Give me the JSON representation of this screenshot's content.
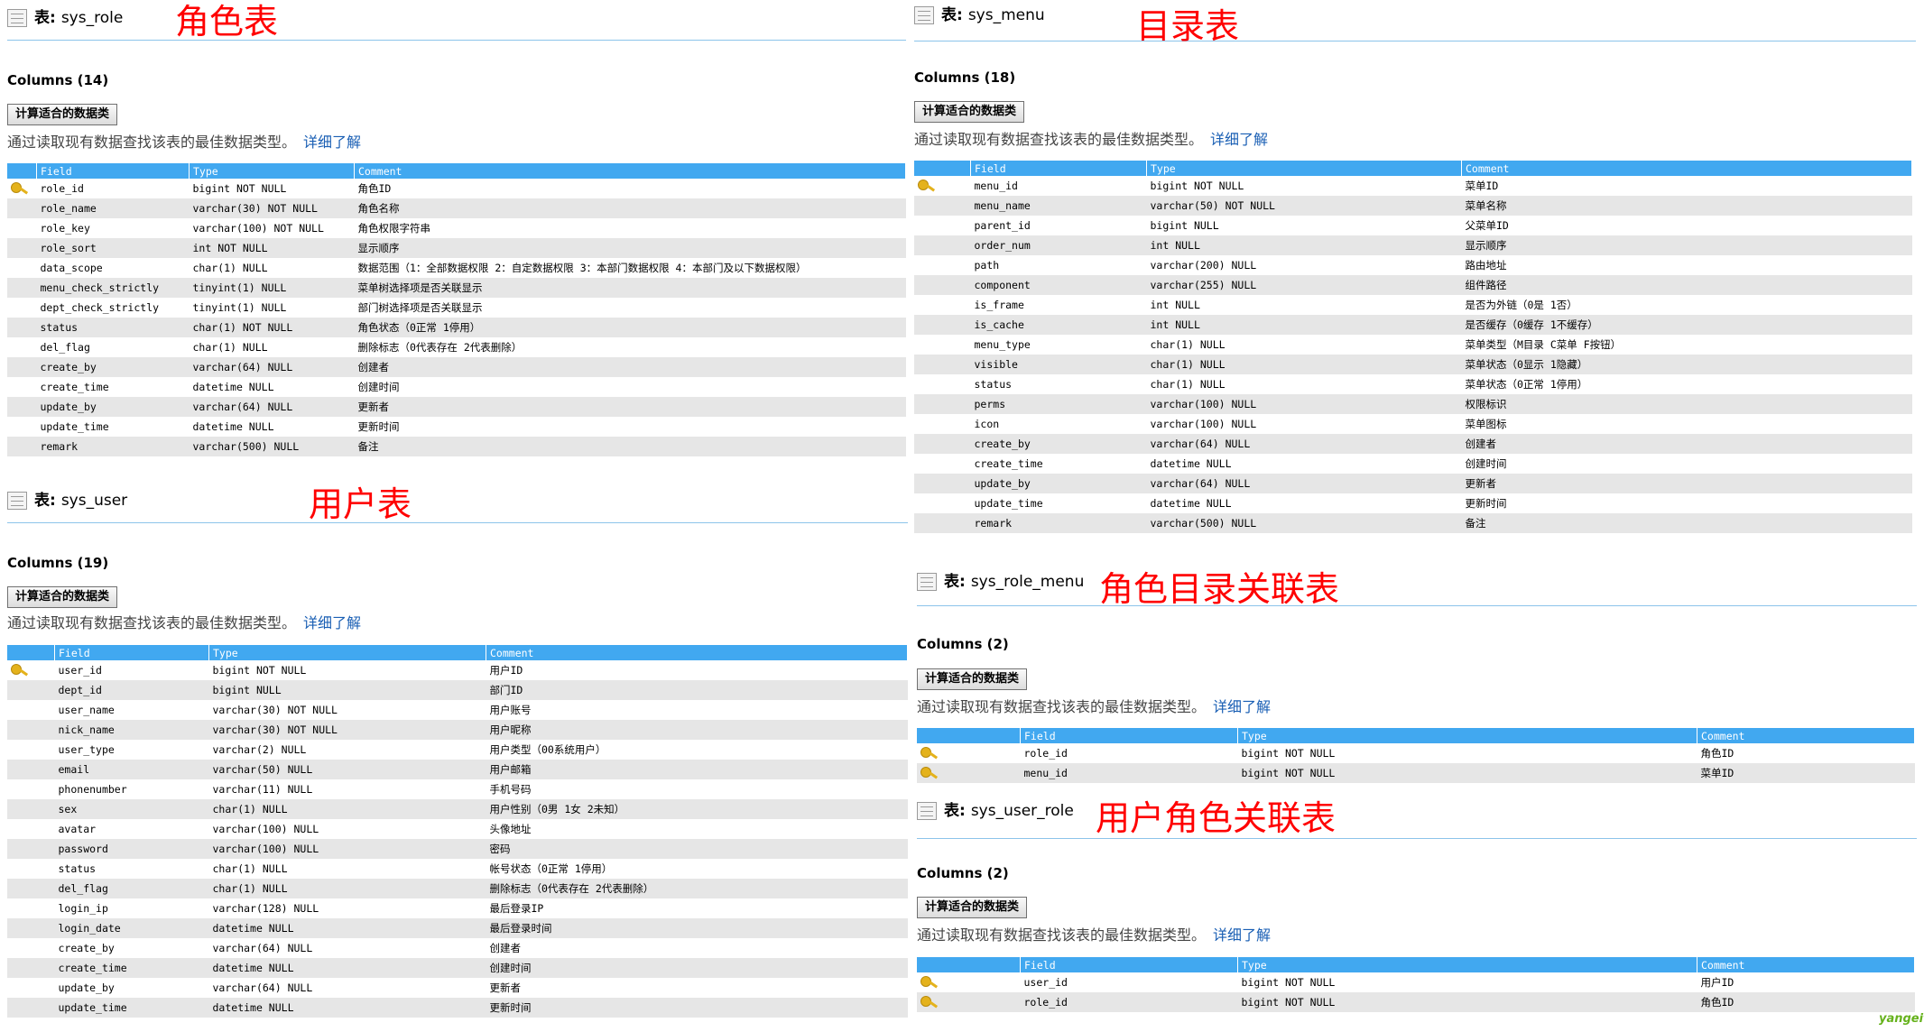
{
  "common": {
    "table_prefix": "表:",
    "calc_button": "计算适合的数据类",
    "hint_text": "通过读取现有数据查找该表的最佳数据类型。",
    "hint_link": "详细了解",
    "headers": {
      "field": "Field",
      "type": "Type",
      "comment": "Comment"
    }
  },
  "sys_role": {
    "name": "sys_role",
    "annotation": "角色表",
    "columns_label": "Columns (14)",
    "rows": [
      {
        "key": true,
        "field": "role_id",
        "type": "bigint NOT NULL",
        "comment": "角色ID"
      },
      {
        "key": false,
        "field": "role_name",
        "type": "varchar(30) NOT NULL",
        "comment": "角色名称"
      },
      {
        "key": false,
        "field": "role_key",
        "type": "varchar(100) NOT NULL",
        "comment": "角色权限字符串"
      },
      {
        "key": false,
        "field": "role_sort",
        "type": "int NOT NULL",
        "comment": "显示顺序"
      },
      {
        "key": false,
        "field": "data_scope",
        "type": "char(1) NULL",
        "comment": "数据范围（1：全部数据权限 2：自定数据权限 3：本部门数据权限 4：本部门及以下数据权限）"
      },
      {
        "key": false,
        "field": "menu_check_strictly",
        "type": "tinyint(1) NULL",
        "comment": "菜单树选择项是否关联显示"
      },
      {
        "key": false,
        "field": "dept_check_strictly",
        "type": "tinyint(1) NULL",
        "comment": "部门树选择项是否关联显示"
      },
      {
        "key": false,
        "field": "status",
        "type": "char(1) NOT NULL",
        "comment": "角色状态（0正常 1停用）"
      },
      {
        "key": false,
        "field": "del_flag",
        "type": "char(1) NULL",
        "comment": "删除标志（0代表存在 2代表删除）"
      },
      {
        "key": false,
        "field": "create_by",
        "type": "varchar(64) NULL",
        "comment": "创建者"
      },
      {
        "key": false,
        "field": "create_time",
        "type": "datetime NULL",
        "comment": "创建时间"
      },
      {
        "key": false,
        "field": "update_by",
        "type": "varchar(64) NULL",
        "comment": "更新者"
      },
      {
        "key": false,
        "field": "update_time",
        "type": "datetime NULL",
        "comment": "更新时间"
      },
      {
        "key": false,
        "field": "remark",
        "type": "varchar(500) NULL",
        "comment": "备注"
      }
    ]
  },
  "sys_user": {
    "name": "sys_user",
    "annotation": "用户表",
    "columns_label": "Columns (19)",
    "rows": [
      {
        "key": true,
        "field": "user_id",
        "type": "bigint NOT NULL",
        "comment": "用户ID"
      },
      {
        "key": false,
        "field": "dept_id",
        "type": "bigint NULL",
        "comment": "部门ID"
      },
      {
        "key": false,
        "field": "user_name",
        "type": "varchar(30) NOT NULL",
        "comment": "用户账号"
      },
      {
        "key": false,
        "field": "nick_name",
        "type": "varchar(30) NOT NULL",
        "comment": "用户昵称"
      },
      {
        "key": false,
        "field": "user_type",
        "type": "varchar(2) NULL",
        "comment": "用户类型（00系统用户）"
      },
      {
        "key": false,
        "field": "email",
        "type": "varchar(50) NULL",
        "comment": "用户邮箱"
      },
      {
        "key": false,
        "field": "phonenumber",
        "type": "varchar(11) NULL",
        "comment": "手机号码"
      },
      {
        "key": false,
        "field": "sex",
        "type": "char(1) NULL",
        "comment": "用户性别（0男 1女 2未知）"
      },
      {
        "key": false,
        "field": "avatar",
        "type": "varchar(100) NULL",
        "comment": "头像地址"
      },
      {
        "key": false,
        "field": "password",
        "type": "varchar(100) NULL",
        "comment": "密码"
      },
      {
        "key": false,
        "field": "status",
        "type": "char(1) NULL",
        "comment": "帐号状态（0正常 1停用）"
      },
      {
        "key": false,
        "field": "del_flag",
        "type": "char(1) NULL",
        "comment": "删除标志（0代表存在 2代表删除）"
      },
      {
        "key": false,
        "field": "login_ip",
        "type": "varchar(128) NULL",
        "comment": "最后登录IP"
      },
      {
        "key": false,
        "field": "login_date",
        "type": "datetime NULL",
        "comment": "最后登录时间"
      },
      {
        "key": false,
        "field": "create_by",
        "type": "varchar(64) NULL",
        "comment": "创建者"
      },
      {
        "key": false,
        "field": "create_time",
        "type": "datetime NULL",
        "comment": "创建时间"
      },
      {
        "key": false,
        "field": "update_by",
        "type": "varchar(64) NULL",
        "comment": "更新者"
      },
      {
        "key": false,
        "field": "update_time",
        "type": "datetime NULL",
        "comment": "更新时间"
      }
    ]
  },
  "sys_menu": {
    "name": "sys_menu",
    "annotation": "目录表",
    "columns_label": "Columns (18)",
    "rows": [
      {
        "key": true,
        "field": "menu_id",
        "type": "bigint NOT NULL",
        "comment": "菜单ID"
      },
      {
        "key": false,
        "field": "menu_name",
        "type": "varchar(50) NOT NULL",
        "comment": "菜单名称"
      },
      {
        "key": false,
        "field": "parent_id",
        "type": "bigint NULL",
        "comment": "父菜单ID"
      },
      {
        "key": false,
        "field": "order_num",
        "type": "int NULL",
        "comment": "显示顺序"
      },
      {
        "key": false,
        "field": "path",
        "type": "varchar(200) NULL",
        "comment": "路由地址"
      },
      {
        "key": false,
        "field": "component",
        "type": "varchar(255) NULL",
        "comment": "组件路径"
      },
      {
        "key": false,
        "field": "is_frame",
        "type": "int NULL",
        "comment": "是否为外链（0是 1否）"
      },
      {
        "key": false,
        "field": "is_cache",
        "type": "int NULL",
        "comment": "是否缓存（0缓存 1不缓存）"
      },
      {
        "key": false,
        "field": "menu_type",
        "type": "char(1) NULL",
        "comment": "菜单类型（M目录 C菜单 F按钮）"
      },
      {
        "key": false,
        "field": "visible",
        "type": "char(1) NULL",
        "comment": "菜单状态（0显示 1隐藏）"
      },
      {
        "key": false,
        "field": "status",
        "type": "char(1) NULL",
        "comment": "菜单状态（0正常 1停用）"
      },
      {
        "key": false,
        "field": "perms",
        "type": "varchar(100) NULL",
        "comment": "权限标识"
      },
      {
        "key": false,
        "field": "icon",
        "type": "varchar(100) NULL",
        "comment": "菜单图标"
      },
      {
        "key": false,
        "field": "create_by",
        "type": "varchar(64) NULL",
        "comment": "创建者"
      },
      {
        "key": false,
        "field": "create_time",
        "type": "datetime NULL",
        "comment": "创建时间"
      },
      {
        "key": false,
        "field": "update_by",
        "type": "varchar(64) NULL",
        "comment": "更新者"
      },
      {
        "key": false,
        "field": "update_time",
        "type": "datetime NULL",
        "comment": "更新时间"
      },
      {
        "key": false,
        "field": "remark",
        "type": "varchar(500) NULL",
        "comment": "备注"
      }
    ]
  },
  "sys_role_menu": {
    "name": "sys_role_menu",
    "annotation": "角色目录关联表",
    "columns_label": "Columns (2)",
    "rows": [
      {
        "key": true,
        "field": "role_id",
        "type": "bigint NOT NULL",
        "comment": "角色ID"
      },
      {
        "key": true,
        "field": "menu_id",
        "type": "bigint NOT NULL",
        "comment": "菜单ID"
      }
    ]
  },
  "sys_user_role": {
    "name": "sys_user_role",
    "annotation": "用户角色关联表",
    "columns_label": "Columns (2)",
    "rows": [
      {
        "key": true,
        "field": "user_id",
        "type": "bigint NOT NULL",
        "comment": "用户ID"
      },
      {
        "key": true,
        "field": "role_id",
        "type": "bigint NOT NULL",
        "comment": "角色ID"
      }
    ]
  },
  "watermark": "yangeit"
}
